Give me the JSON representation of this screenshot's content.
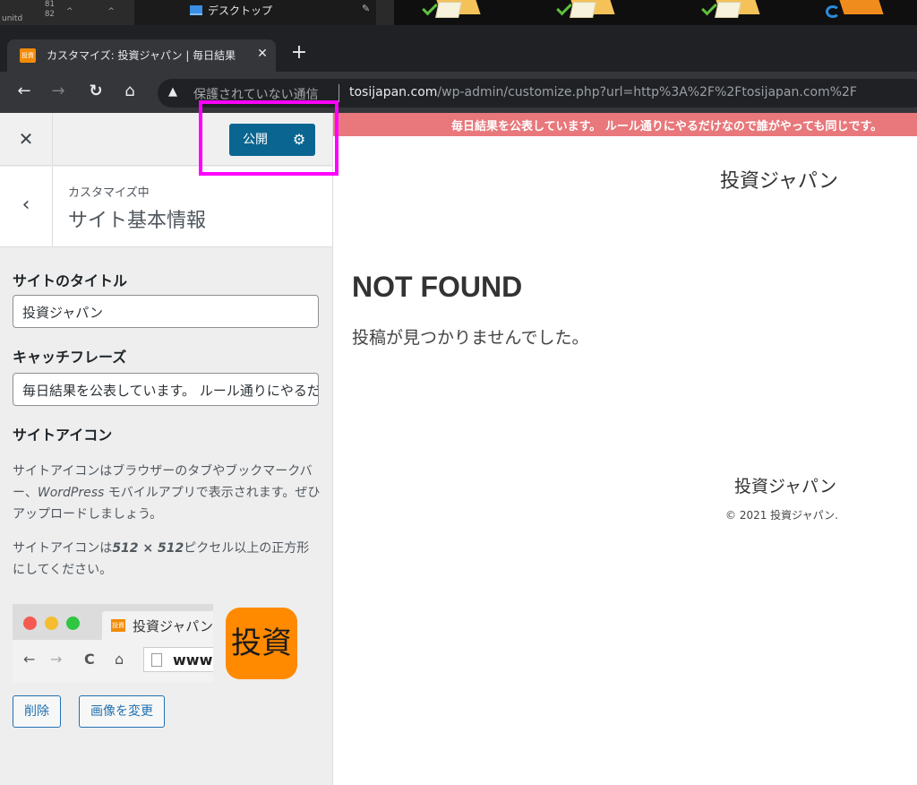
{
  "taskbar": {
    "numbers": [
      "81",
      "82"
    ],
    "cut_text": "unitd",
    "carets": "^ ^",
    "desktop_label": "デスクトップ",
    "pin_icon": "pin-icon"
  },
  "browser": {
    "tab": {
      "favicon_text": "投資",
      "title": "カスタマイズ: 投資ジャパン | 毎日結果",
      "close": "✕"
    },
    "newtab": "+",
    "nav": {
      "back": "←",
      "forward": "→",
      "reload": "↻",
      "home": "⌂"
    },
    "address": {
      "warning": "▲",
      "insecure_label": "保護されていない通信",
      "host": "tosijapan.com",
      "path": "/wp-admin/customize.php?url=http%3A%2F%2Ftosijapan.com%2F"
    }
  },
  "customizer": {
    "close": "✕",
    "publish_label": "公開",
    "settings_icon": "⚙",
    "back": "‹",
    "section_sub": "カスタマイズ中",
    "section_title": "サイト基本情報",
    "site_title_label": "サイトのタイトル",
    "site_title_value": "投資ジャパン",
    "tagline_label": "キャッチフレーズ",
    "tagline_value": "毎日結果を公表しています。 ルール通りにやるだけなので誰がやっても同じです。",
    "icon_label": "サイトアイコン",
    "icon_desc_1a": "サイトアイコンはブラウザーのタブやブックマークバー、",
    "icon_desc_1b": "WordPress",
    "icon_desc_1c": " モバイルアプリで表示されます。ぜひアップロードしましょう。",
    "icon_desc_2a": "サイトアイコンは",
    "icon_desc_2b": "512 × 512",
    "icon_desc_2c": "ピクセル以上の正方形にしてください。",
    "preview": {
      "tab_title": "投資ジャパン",
      "url_text": "www.",
      "favicon_text": "投資"
    },
    "big_icon_text": "投資",
    "remove_label": "削除",
    "change_label": "画像を変更"
  },
  "site": {
    "banner": "毎日結果を公表しています。 ルール通りにやるだけなので誰がやっても同じです。",
    "title": "投資ジャパン",
    "not_found": "NOT FOUND",
    "not_found_msg": "投稿が見つかりませんでした。",
    "footer_title": "投資ジャパン",
    "footer_copy": "© 2021 投資ジャパン."
  },
  "colors": {
    "publish": "#0a6690",
    "highlight": "#ff00ff",
    "banner": "#e8787b",
    "site_icon": "#ff8a00"
  }
}
